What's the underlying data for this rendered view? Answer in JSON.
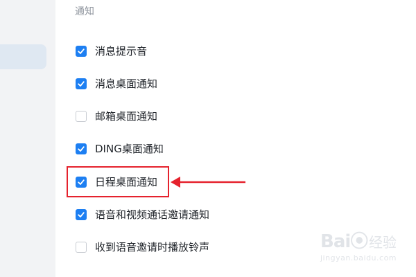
{
  "section": {
    "title": "通知"
  },
  "options": [
    {
      "label": "消息提示音",
      "checked": true
    },
    {
      "label": "消息桌面通知",
      "checked": true
    },
    {
      "label": "邮箱桌面通知",
      "checked": false
    },
    {
      "label": "DING桌面通知",
      "checked": true
    },
    {
      "label": "日程桌面通知",
      "checked": true
    },
    {
      "label": "语音和视频通话邀请通知",
      "checked": true
    },
    {
      "label": "收到语音邀请时播放铃声",
      "checked": false
    }
  ],
  "colors": {
    "accent": "#1d7ff2",
    "annotation": "#e5222d",
    "sidebar_bg": "#f2f3f5",
    "sidebar_active": "#dfe8f2"
  },
  "watermark": {
    "brand": "Bai⦿",
    "brand_cn": "经验",
    "url": "jingyan.baidu.com"
  }
}
